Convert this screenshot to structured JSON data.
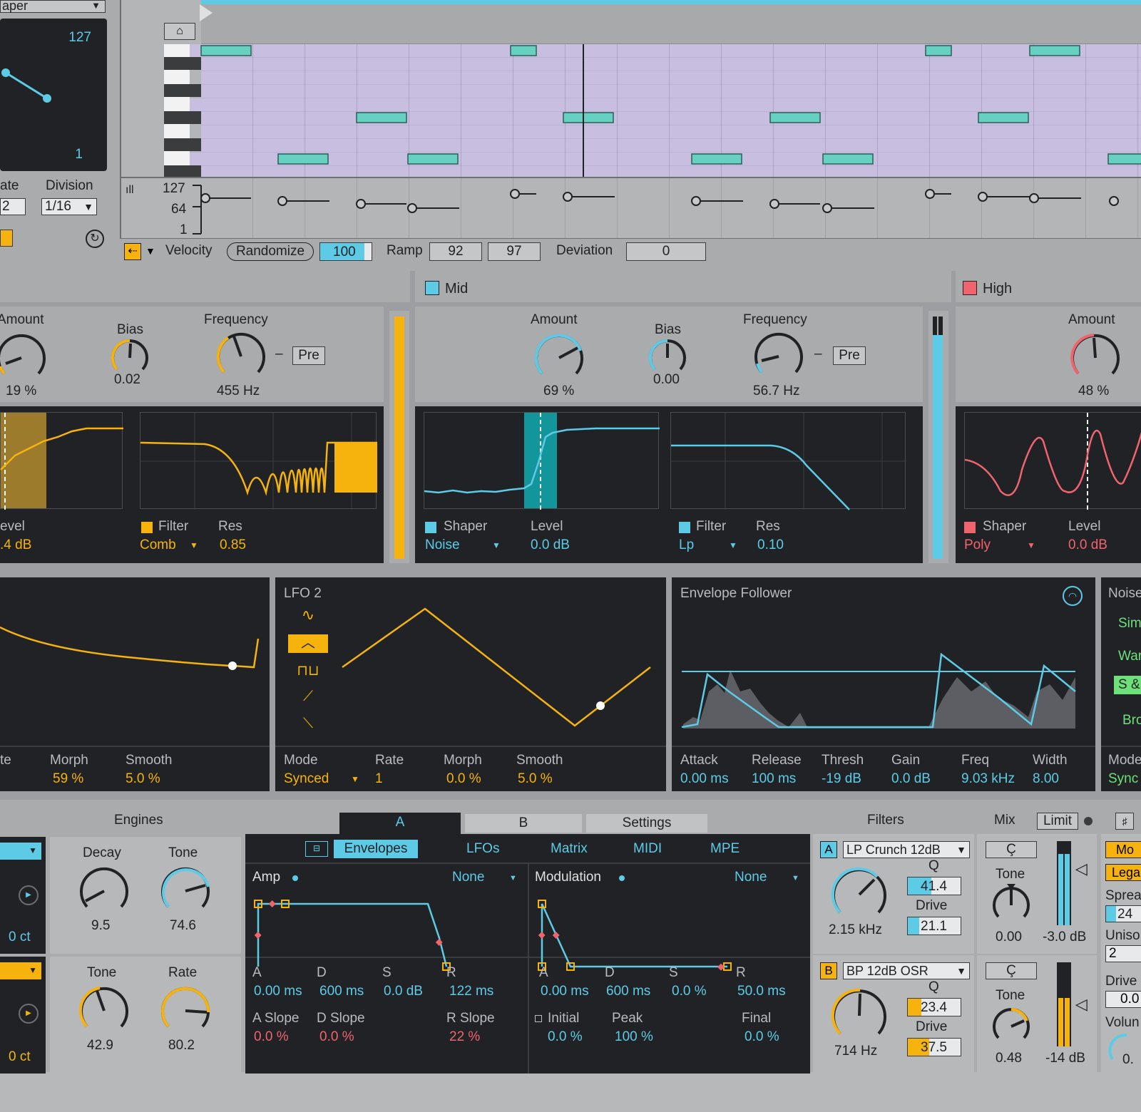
{
  "colors": {
    "accent_cyan": "#5ecbe6",
    "accent_orange": "#f6b30e",
    "accent_red": "#f0646e",
    "note": "#66d1c1",
    "piano_roll_bg": "#c8bfe0",
    "panel_dark": "#202225",
    "panel_light": "#a9abad"
  },
  "arpeggiator": {
    "device_name_partial": "aper",
    "range_top": "127",
    "range_bottom": "1",
    "rate_label_partial": "ate",
    "rate_value_partial": "2",
    "division_label": "Division",
    "division_value": "1/16"
  },
  "velocity_lane": {
    "max": "127",
    "mid": "64",
    "min": "1"
  },
  "note_toolbar": {
    "velocity_label": "Velocity",
    "randomize_label": "Randomize",
    "velocity_value": "100",
    "ramp_label": "Ramp",
    "ramp_start": "92",
    "ramp_end": "97",
    "deviation_label": "Deviation",
    "deviation_value": "0"
  },
  "bands": {
    "low": {
      "amount_label_partial": "Amount",
      "amount_value": "19 %",
      "bias_label": "Bias",
      "bias_value": "0.02",
      "frequency_label": "Frequency",
      "frequency_value": "455 Hz",
      "pre_label": "Pre",
      "level_label_partial": "evel",
      "level_value_partial": ".4 dB",
      "filter_label": "Filter",
      "filter_type": "Comb",
      "res_label": "Res",
      "res_value": "0.85"
    },
    "mid": {
      "name": "Mid",
      "amount_label": "Amount",
      "amount_value": "69 %",
      "bias_label": "Bias",
      "bias_value": "0.00",
      "frequency_label": "Frequency",
      "frequency_value": "56.7 Hz",
      "pre_label": "Pre",
      "shaper_label": "Shaper",
      "shaper_type": "Noise",
      "level_label": "Level",
      "level_value": "0.0 dB",
      "filter_label": "Filter",
      "filter_type": "Lp",
      "res_label": "Res",
      "res_value": "0.10"
    },
    "high": {
      "name": "High",
      "amount_label": "Amount",
      "amount_value": "48 %",
      "shaper_label": "Shaper",
      "shaper_type": "Poly",
      "level_label": "Level",
      "level_value": "0.0 dB"
    }
  },
  "lfo1": {
    "rate_label_partial": "te",
    "morph_label": "Morph",
    "morph_value": "59 %",
    "smooth_label": "Smooth",
    "smooth_value": "5.0 %"
  },
  "lfo2": {
    "title": "LFO 2",
    "mode_label": "Mode",
    "mode_value": "Synced",
    "rate_label": "Rate",
    "rate_value": "1",
    "morph_label": "Morph",
    "morph_value": "0.0 %",
    "smooth_label": "Smooth",
    "smooth_value": "5.0 %"
  },
  "envelope_follower": {
    "title": "Envelope Follower",
    "attack_label": "Attack",
    "attack_value": "0.00 ms",
    "release_label": "Release",
    "release_value": "100 ms",
    "thresh_label": "Thresh",
    "thresh_value": "-19 dB",
    "gain_label": "Gain",
    "gain_value": "0.0 dB",
    "freq_label": "Freq",
    "freq_value": "9.03 kHz",
    "width_label": "Width",
    "width_value": "8.00"
  },
  "noise_partial": {
    "title": "Noise",
    "items": [
      "Simp",
      "War",
      "S &",
      "Bro"
    ],
    "mode_label": "Mode",
    "mode_value": "Sync"
  },
  "synth": {
    "engines_label": "Engines",
    "tabs": [
      "A",
      "B",
      "Settings"
    ],
    "subtabs": [
      "Envelopes",
      "LFOs",
      "Matrix",
      "MIDI",
      "MPE"
    ],
    "filters_label": "Filters",
    "mix_label": "Mix",
    "limit_label": "Limit",
    "engine1": {
      "tune_partial": "0 ct",
      "decay_label": "Decay",
      "decay_value": "9.5",
      "tone_label": "Tone",
      "tone_value": "74.6"
    },
    "engine2": {
      "tune_partial": "0 ct",
      "tone_label": "Tone",
      "tone_value": "42.9",
      "rate_label": "Rate",
      "rate_value": "80.2"
    },
    "amp": {
      "label": "Amp",
      "target": "None",
      "a_label": "A",
      "a_value": "0.00 ms",
      "d_label": "D",
      "d_value": "600 ms",
      "s_label": "S",
      "s_value": "0.0 dB",
      "r_label": "R",
      "r_value": "122 ms",
      "a_slope_label": "A Slope",
      "a_slope_value": "0.0 %",
      "d_slope_label": "D Slope",
      "d_slope_value": "0.0 %",
      "r_slope_label": "R Slope",
      "r_slope_value": "22 %"
    },
    "modulation": {
      "label": "Modulation",
      "target": "None",
      "a_label": "A",
      "a_value": "0.00 ms",
      "d_label": "D",
      "d_value": "600 ms",
      "s_label": "S",
      "s_value": "0.0 %",
      "r_label": "R",
      "r_value": "50.0 ms",
      "initial_label": "Initial",
      "initial_value": "0.0 %",
      "peak_label": "Peak",
      "peak_value": "100 %",
      "final_label": "Final",
      "final_value": "0.0 %"
    },
    "filter_a": {
      "slot": "A",
      "type": "LP Crunch 12dB",
      "freq_value": "2.15 kHz",
      "q_label": "Q",
      "q_value": "41.4",
      "drive_label": "Drive",
      "drive_value": "21.1",
      "q_fill": 0.45,
      "drive_fill": 0.22
    },
    "filter_b": {
      "slot": "B",
      "type": "BP 12dB OSR",
      "freq_value": "714 Hz",
      "q_label": "Q",
      "q_value": "23.4",
      "drive_label": "Drive",
      "drive_value": "37.5",
      "q_fill": 0.25,
      "drive_fill": 0.4
    },
    "mix_a": {
      "tone_label": "Tone",
      "tone_value": "0.00",
      "gain_value": "-3.0 dB"
    },
    "mix_b": {
      "tone_label": "Tone",
      "tone_value": "0.48",
      "gain_value": "-14 dB"
    },
    "right_partial": {
      "mode_label": "Mo",
      "legato_label": "Lega",
      "spread_label": "Sprea",
      "spread_value": "24",
      "unison_label": "Uniso",
      "unison_value": "2",
      "drive_label": "Drive",
      "drive_value": "0.0",
      "volume_label": "Volun",
      "volume_value": "0."
    }
  }
}
